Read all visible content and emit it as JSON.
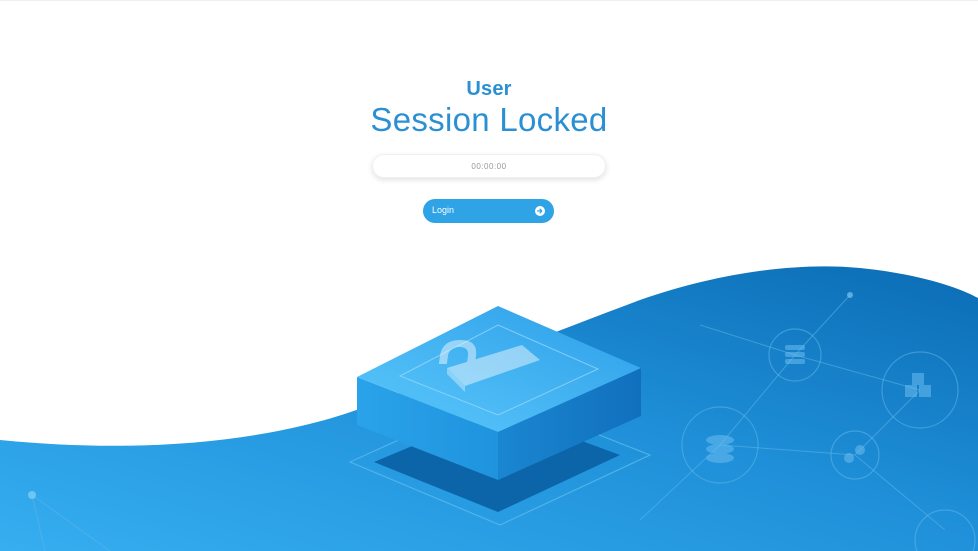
{
  "lock_screen": {
    "user_name": "User",
    "title": "Session Locked",
    "timer_value": "",
    "timer_placeholder": "00:00:00",
    "login_label": "Login",
    "login_icon": "arrow-circle-right-icon"
  },
  "illustration": {
    "main_object": "padlock-icon",
    "network_icons": [
      "stack-icon",
      "cubes-icon",
      "database-icon",
      "link-icon"
    ]
  },
  "colors": {
    "accent": "#2a8fd3",
    "button": "#2ea3e6",
    "wave_light": "#36aef0",
    "wave_dark": "#0b6cb4"
  }
}
